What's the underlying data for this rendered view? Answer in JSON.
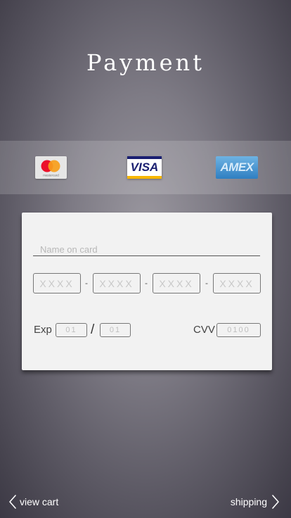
{
  "header": {
    "title": "Payment"
  },
  "card_brands": [
    {
      "name": "mastercard",
      "text": "mastercard",
      "colors": [
        "#eb001b",
        "#f79e1b"
      ]
    },
    {
      "name": "visa",
      "text": "VISA",
      "colors": [
        "#1a1f71",
        "#f7b600"
      ]
    },
    {
      "name": "amex",
      "text": "AMEX",
      "colors": [
        "#2f7fc1",
        "#d8ecfa"
      ]
    }
  ],
  "form": {
    "name_placeholder": "Name on card",
    "number_placeholders": [
      "XXXX",
      "XXXX",
      "XXXX",
      "XXXX"
    ],
    "separator": "-",
    "exp_label": "Exp",
    "exp_month_placeholder": "01",
    "exp_slash": "/",
    "exp_year_placeholder": "01",
    "cvv_label": "CVV",
    "cvv_placeholder": "0100"
  },
  "footer": {
    "back_label": "view cart",
    "back_icon": "chevron-left-icon",
    "next_label": "shipping",
    "next_icon": "chevron-right-icon"
  }
}
